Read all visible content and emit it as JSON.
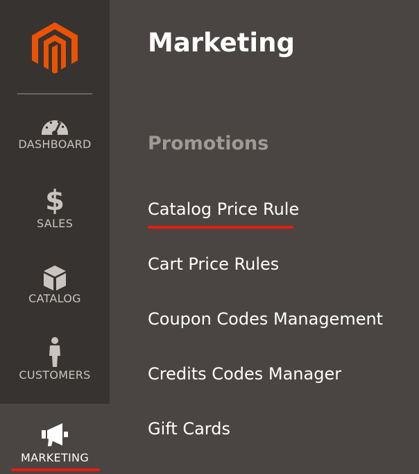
{
  "sidebar": {
    "logo": "magento-logo",
    "items": [
      {
        "label": "DASHBOARD",
        "icon": "dashboard-gauge-icon"
      },
      {
        "label": "SALES",
        "icon": "dollar-icon"
      },
      {
        "label": "CATALOG",
        "icon": "box-icon"
      },
      {
        "label": "CUSTOMERS",
        "icon": "person-icon"
      },
      {
        "label": "MARKETING",
        "icon": "megaphone-icon",
        "active": true
      }
    ]
  },
  "panel": {
    "title": "Marketing",
    "section": "Promotions",
    "links": [
      {
        "label": "Catalog Price Rule",
        "highlighted": true
      },
      {
        "label": "Cart Price Rules"
      },
      {
        "label": "Coupon Codes Management"
      },
      {
        "label": "Credits Codes Manager"
      },
      {
        "label": "Gift Cards"
      }
    ]
  },
  "colors": {
    "brand": "#eb5202",
    "accent_underline": "#eb1c0f",
    "sidebar_bg": "#373330",
    "panel_bg": "#4a4542"
  }
}
